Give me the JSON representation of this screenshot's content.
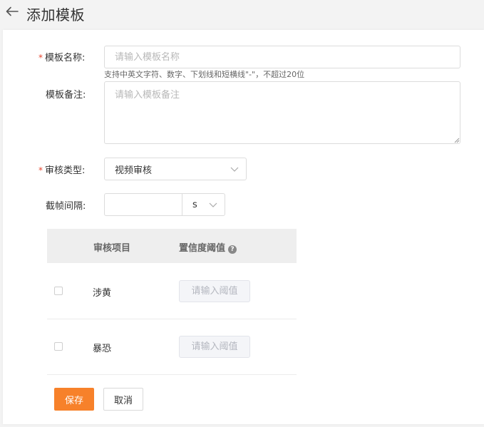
{
  "header": {
    "title": "添加模板"
  },
  "form": {
    "name": {
      "required_mark": "*",
      "label": "模板名称:",
      "placeholder": "请输入模板名称",
      "hint": "支持中英文字符、数字、下划线和短横线\"-\"，不超过20位"
    },
    "note": {
      "label": "模板备注:",
      "placeholder": "请输入模板备注"
    },
    "review_type": {
      "required_mark": "*",
      "label": "审核类型:",
      "value": "视频审核"
    },
    "frame_interval": {
      "label": "截帧间隔:",
      "value": "",
      "unit": "s"
    }
  },
  "table": {
    "columns": [
      "审核项目",
      "置信度阈值"
    ],
    "help_glyph": "?",
    "rows": [
      {
        "item": "涉黄",
        "threshold_placeholder": "请输入阈值"
      },
      {
        "item": "暴恐",
        "threshold_placeholder": "请输入阈值"
      }
    ]
  },
  "actions": {
    "save_label": "保存",
    "cancel_label": "取消"
  },
  "colors": {
    "accent": "#f7812a",
    "required": "#e6452e",
    "table_header_bg": "#eeeeee"
  },
  "icons": {
    "back": "arrow-left-icon",
    "dropdown": "chevron-down-icon",
    "help": "question-circle-icon"
  }
}
